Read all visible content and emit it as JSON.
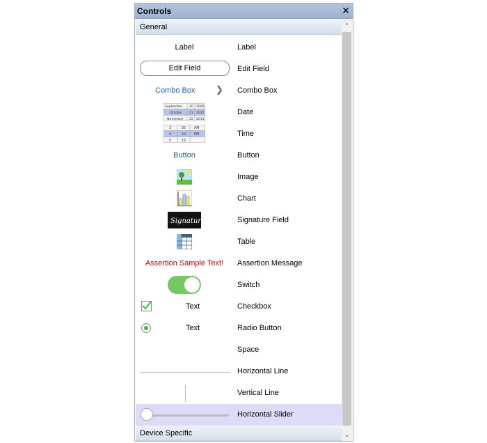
{
  "panel": {
    "title": "Controls",
    "close_glyph": "✕",
    "groups": [
      {
        "label": "General"
      },
      {
        "label": "Device Specific"
      }
    ]
  },
  "scrollbar": {
    "up_glyph": "⌃",
    "down_glyph": "⌄"
  },
  "items": [
    {
      "label": "Label",
      "preview_text": "Label"
    },
    {
      "label": "Edit Field",
      "preview_text": "Edit Field"
    },
    {
      "label": "Combo Box",
      "preview_text": "Combo Box"
    },
    {
      "label": "Date",
      "preview_rows": [
        [
          "September",
          "20",
          "2009"
        ],
        [
          "October",
          "21",
          "2010"
        ],
        [
          "November",
          "22",
          "2011"
        ]
      ]
    },
    {
      "label": "Time",
      "preview_rows": [
        [
          "3",
          "05",
          "AM"
        ],
        [
          "4",
          "10",
          "PM"
        ],
        [
          "5",
          "15",
          ""
        ]
      ]
    },
    {
      "label": "Button",
      "preview_text": "Button"
    },
    {
      "label": "Image"
    },
    {
      "label": "Chart"
    },
    {
      "label": "Signature Field",
      "preview_text": "Signature"
    },
    {
      "label": "Table"
    },
    {
      "label": "Assertion Message",
      "preview_text": "Assertion Sample Text!"
    },
    {
      "label": "Switch",
      "switch_on": true
    },
    {
      "label": "Checkbox",
      "preview_text": "Text",
      "checked": true
    },
    {
      "label": "Radio Button",
      "preview_text": "Text",
      "selected": true
    },
    {
      "label": "Space"
    },
    {
      "label": "Horizontal Line"
    },
    {
      "label": "Vertical Line"
    },
    {
      "label": "Horizontal Slider",
      "slider_value": 0
    }
  ],
  "colors": {
    "selection": "#dcdcf8",
    "switch_on": "#76c862",
    "link_blue": "#1a5fa8",
    "assertion_red": "#e00000",
    "check_green": "#35c335"
  }
}
